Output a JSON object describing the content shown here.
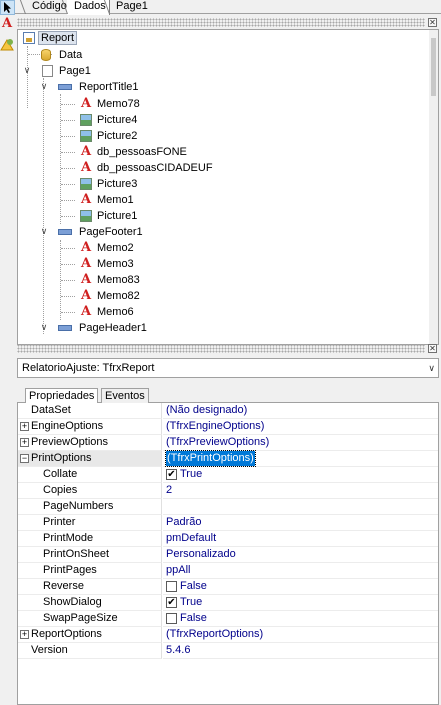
{
  "toolbar": {
    "tools": [
      {
        "icon": "pointer-icon",
        "selected": true
      },
      {
        "icon": "text-tool-icon",
        "glyph": "A",
        "color": "#d02020"
      },
      {
        "icon": "shape-tool-icon",
        "color": "#e8a000"
      }
    ]
  },
  "tabs": [
    {
      "label": "Código",
      "active": false
    },
    {
      "label": "Dados",
      "active": true
    },
    {
      "label": "Page1",
      "active": false
    }
  ],
  "tree": {
    "nodes": [
      {
        "label": "Report",
        "icon": "report-icon",
        "selected": true
      },
      {
        "label": "Data",
        "icon": "database-icon"
      },
      {
        "label": "Page1",
        "icon": "page-icon",
        "expanded": true
      },
      {
        "label": "ReportTitle1",
        "icon": "band-icon",
        "expanded": true
      },
      {
        "label": "Memo78",
        "icon": "memo-icon"
      },
      {
        "label": "Picture4",
        "icon": "picture-icon"
      },
      {
        "label": "Picture2",
        "icon": "picture-icon"
      },
      {
        "label": "db_pessoasFONE",
        "icon": "memo-icon"
      },
      {
        "label": "db_pessoasCIDADEUF",
        "icon": "memo-icon"
      },
      {
        "label": "Picture3",
        "icon": "picture-icon"
      },
      {
        "label": "Memo1",
        "icon": "memo-icon"
      },
      {
        "label": "Picture1",
        "icon": "picture-icon"
      },
      {
        "label": "PageFooter1",
        "icon": "band-icon",
        "expanded": true
      },
      {
        "label": "Memo2",
        "icon": "memo-icon"
      },
      {
        "label": "Memo3",
        "icon": "memo-icon"
      },
      {
        "label": "Memo83",
        "icon": "memo-icon"
      },
      {
        "label": "Memo82",
        "icon": "memo-icon"
      },
      {
        "label": "Memo6",
        "icon": "memo-icon"
      },
      {
        "label": "PageHeader1",
        "icon": "band-icon",
        "expanded": true
      }
    ]
  },
  "inspector": {
    "object_selector": "RelatorioAjuste: TfrxReport",
    "tabs": [
      {
        "label": "Propriedades",
        "active": true
      },
      {
        "label": "Eventos",
        "active": false
      }
    ],
    "properties": [
      {
        "name": "DataSet",
        "value": "(Não designado)"
      },
      {
        "name": "EngineOptions",
        "value": "(TfrxEngineOptions)",
        "expander": "+"
      },
      {
        "name": "PreviewOptions",
        "value": "(TfrxPreviewOptions)",
        "expander": "+"
      },
      {
        "name": "PrintOptions",
        "value": "(TfrxPrintOptions)",
        "expander": "−",
        "selected": true
      },
      {
        "name": "Collate",
        "value": "True",
        "checked": true,
        "child": true
      },
      {
        "name": "Copies",
        "value": "2",
        "child": true
      },
      {
        "name": "PageNumbers",
        "value": "",
        "child": true
      },
      {
        "name": "Printer",
        "value": "Padrão",
        "child": true
      },
      {
        "name": "PrintMode",
        "value": "pmDefault",
        "child": true
      },
      {
        "name": "PrintOnSheet",
        "value": "Personalizado",
        "child": true
      },
      {
        "name": "PrintPages",
        "value": "ppAll",
        "child": true
      },
      {
        "name": "Reverse",
        "value": "False",
        "checked": false,
        "child": true
      },
      {
        "name": "ShowDialog",
        "value": "True",
        "checked": true,
        "child": true
      },
      {
        "name": "SwapPageSize",
        "value": "False",
        "checked": false,
        "child": true
      },
      {
        "name": "ReportOptions",
        "value": "(TfrxReportOptions)",
        "expander": "+"
      },
      {
        "name": "Version",
        "value": "5.4.6"
      }
    ]
  },
  "colors": {
    "value_text": "#00008b",
    "selection": "#0078d7",
    "memo_icon": "#d02020"
  }
}
